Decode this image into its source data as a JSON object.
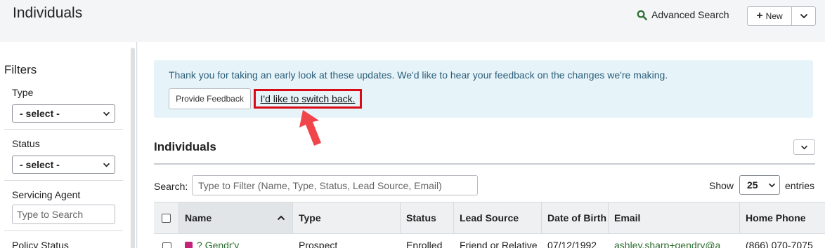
{
  "header": {
    "title": "Individuals",
    "advanced_search": "Advanced Search",
    "new_label": "New"
  },
  "sidebar": {
    "title": "Filters",
    "type_label": "Type",
    "type_value": "- select -",
    "status_label": "Status",
    "status_value": "- select -",
    "agent_label": "Servicing Agent",
    "agent_placeholder": "Type to Search",
    "policy_status_label": "Policy Status"
  },
  "banner": {
    "message": "Thank you for taking an early look at these updates. We'd like to hear your feedback on the changes we're making.",
    "feedback_button": "Provide Feedback",
    "switch_back_link": "I'd like to switch back."
  },
  "section": {
    "title": "Individuals"
  },
  "search": {
    "label": "Search:",
    "placeholder": "Type to Filter (Name, Type, Status, Lead Source, Email)"
  },
  "paging": {
    "show_label": "Show",
    "page_size": "25",
    "entries_label": "entries"
  },
  "table": {
    "columns": {
      "name": "Name",
      "type": "Type",
      "status": "Status",
      "lead_source": "Lead Source",
      "dob": "Date of Birth",
      "email": "Email",
      "phone": "Home Phone"
    },
    "rows": [
      {
        "name": "? Gendr'y",
        "type": "Prospect",
        "status": "Enrolled",
        "lead_source": "Friend or Relative",
        "dob": "07/12/1992",
        "email": "ashley.sharp+gendry@a",
        "phone": "(866) 070-7075"
      }
    ]
  },
  "colors": {
    "banner_bg": "#e6f3f9",
    "banner_text": "#2a5e78",
    "highlight_box": "#d90b16",
    "arrow": "#f0454a",
    "link_green": "#2c6e2f",
    "name_tag": "#c4237a"
  }
}
